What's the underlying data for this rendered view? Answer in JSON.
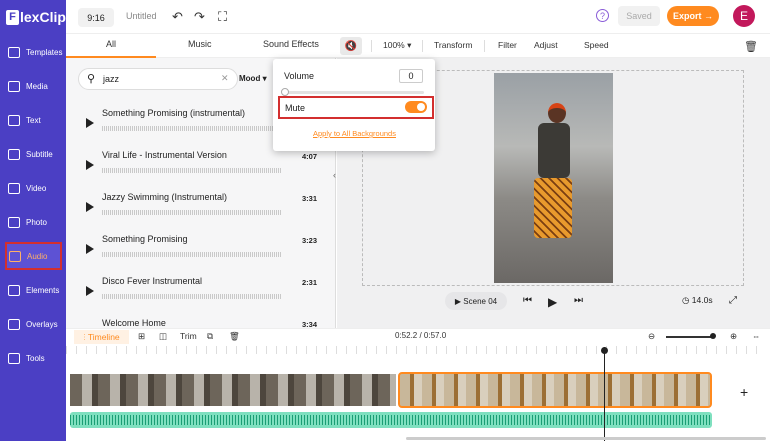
{
  "brand": {
    "logo_text": "lexClip",
    "logo_letter": "F",
    "accent": "#ff8a1f",
    "sidebar_color": "#4b3fc4"
  },
  "topbar": {
    "ratio": "9:16",
    "title": "Untitled",
    "saved": "Saved",
    "export": "Export →",
    "avatar": "E"
  },
  "sidebar": {
    "items": [
      {
        "label": "Templates"
      },
      {
        "label": "Media"
      },
      {
        "label": "Text"
      },
      {
        "label": "Subtitle"
      },
      {
        "label": "Video"
      },
      {
        "label": "Photo"
      },
      {
        "label": "Audio"
      },
      {
        "label": "Elements"
      },
      {
        "label": "Overlays"
      },
      {
        "label": "Tools"
      }
    ]
  },
  "tabs": [
    "All",
    "Music",
    "Sound Effects"
  ],
  "editor_toolbar": {
    "zoom": "100%",
    "items": [
      "Transform",
      "Filter",
      "Adjust",
      "Speed"
    ]
  },
  "search": {
    "value": "jazz",
    "filter": "Mood"
  },
  "tracks": [
    {
      "name": "Something Promising (instrumental)",
      "duration": ""
    },
    {
      "name": "Viral Life - Instrumental Version",
      "duration": "4:07"
    },
    {
      "name": "Jazzy Swimming (Instrumental)",
      "duration": "3:31"
    },
    {
      "name": "Something Promising",
      "duration": "3:23"
    },
    {
      "name": "Disco Fever Instrumental",
      "duration": "2:31"
    },
    {
      "name": "Welcome Home",
      "duration": "3:34"
    }
  ],
  "popup": {
    "volume_label": "Volume",
    "volume_value": "0",
    "mute_label": "Mute",
    "apply_all": "Apply to All Backgrounds"
  },
  "preview": {
    "scene": "Scene 04",
    "time": "14.0s"
  },
  "timeline": {
    "label": "Timeline",
    "trim": "Trim",
    "time": "0:52.2 / 0:57.0"
  }
}
